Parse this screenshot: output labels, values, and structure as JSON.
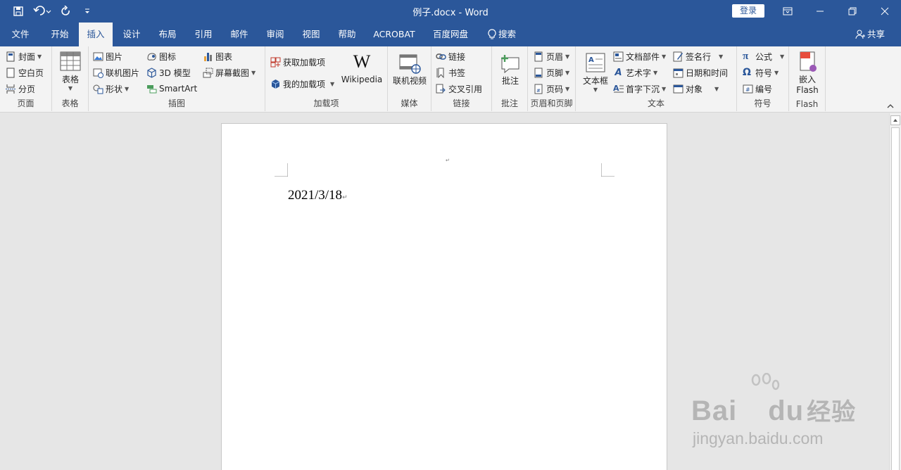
{
  "window": {
    "title": "例子.docx  -  Word",
    "login_label": "登录"
  },
  "tabs": [
    {
      "label": "文件"
    },
    {
      "label": "开始"
    },
    {
      "label": "插入"
    },
    {
      "label": "设计"
    },
    {
      "label": "布局"
    },
    {
      "label": "引用"
    },
    {
      "label": "邮件"
    },
    {
      "label": "审阅"
    },
    {
      "label": "视图"
    },
    {
      "label": "帮助"
    },
    {
      "label": "ACROBAT"
    },
    {
      "label": "百度网盘"
    },
    {
      "label": "搜索"
    }
  ],
  "share_label": "共享",
  "groups": {
    "pages": {
      "label": "页面",
      "cover": "封面",
      "blank": "空白页",
      "break": "分页"
    },
    "tables": {
      "label": "表格",
      "table": "表格"
    },
    "illustrations": {
      "label": "插图",
      "picture": "图片",
      "online_picture": "联机图片",
      "shapes": "形状",
      "icons": "图标",
      "model3d": "3D 模型",
      "smartart": "SmartArt",
      "chart": "图表",
      "screenshot": "屏幕截图"
    },
    "addins": {
      "label": "加载项",
      "get_addins": "获取加载项",
      "my_addins": "我的加载项",
      "wikipedia": "Wikipedia"
    },
    "media": {
      "label": "媒体",
      "online_video": "联机视频"
    },
    "links": {
      "label": "链接",
      "link": "链接",
      "bookmark": "书签",
      "cross_ref": "交叉引用"
    },
    "comments": {
      "label": "批注",
      "comment": "批注"
    },
    "header_footer": {
      "label": "页眉和页脚",
      "header": "页眉",
      "footer": "页脚",
      "page_number": "页码"
    },
    "text": {
      "label": "文本",
      "textbox": "文本框",
      "quick_parts": "文档部件",
      "wordart": "艺术字",
      "dropcap": "首字下沉",
      "signature": "签名行",
      "datetime": "日期和时间",
      "object": "对象"
    },
    "symbols": {
      "label": "符号",
      "equation": "公式",
      "symbol": "符号",
      "number": "编号"
    },
    "flash": {
      "label": "Flash",
      "embed_line1": "嵌入",
      "embed_line2": "Flash"
    }
  },
  "document": {
    "text": "2021/3/18"
  },
  "watermark": {
    "brand": "Bai",
    "brand2": "du",
    "cn": "经验",
    "url": "jingyan.baidu.com"
  },
  "colors": {
    "accent": "#2b579a",
    "ribbon": "#f3f3f3"
  }
}
